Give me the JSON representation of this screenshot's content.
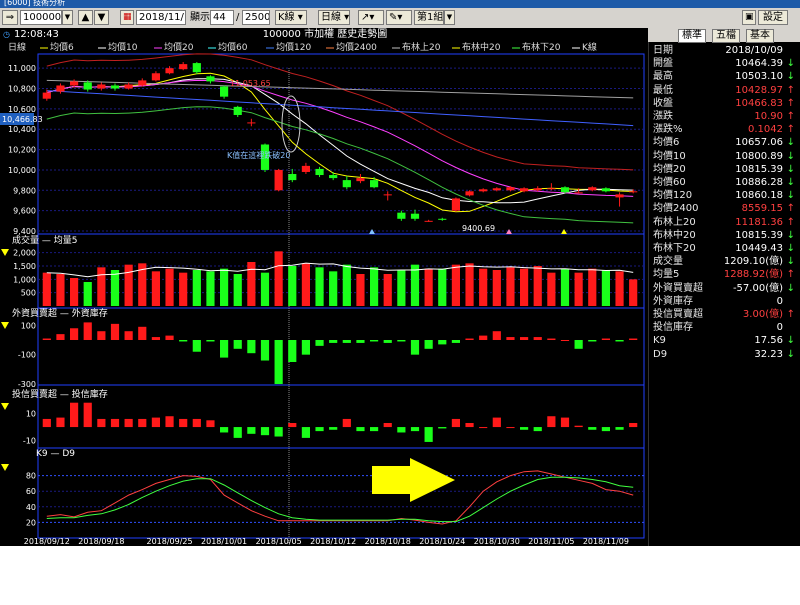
{
  "window": {
    "title": "[6000] 技術分析"
  },
  "toolbar": {
    "symbol": "100000",
    "date": "2018/11/",
    "display_label": "顯示",
    "display_count": "44",
    "display_total": "2500",
    "kline_label": "K線",
    "period_label": "日線",
    "page_label": "第1組",
    "settings_label": "設定"
  },
  "chart_header": {
    "time": "12:08:43",
    "period": "日線",
    "title": "100000 市加權  歷史走勢圖",
    "legend": [
      "均價6",
      "均價10",
      "均價20",
      "均價60",
      "均價120",
      "均價2400",
      "布林上20",
      "布林中20",
      "布林下20",
      "K線"
    ]
  },
  "price_panel": {
    "y_ticks": [
      "11,000",
      "10,800",
      "10,600",
      "10,400",
      "10,200",
      "10,000",
      "9,800",
      "9,600",
      "9,400"
    ],
    "last_price_tag": "10,466.83",
    "high_label": "11,053.65",
    "low_label": "9400.69",
    "annotation": "K值在這裡跌破20"
  },
  "volume_panel": {
    "legend": "成交量 — 均量5",
    "y_ticks": [
      "2,000",
      "1,500",
      "1,000",
      "500"
    ]
  },
  "foreign_panel": {
    "legend": "外資買賣超 — 外資庫存",
    "y_ticks": [
      "100",
      "-100",
      "-300"
    ]
  },
  "trust_panel": {
    "legend": "投信買賣超 — 投信庫存",
    "y_ticks": [
      "10",
      "-10"
    ]
  },
  "kd_panel": {
    "legend": "K9 — D9",
    "y_ticks": [
      "80",
      "60",
      "40",
      "20"
    ]
  },
  "x_dates": [
    "2018/09/12",
    "2018/09/18",
    "2018/09/25",
    "2018/10/01",
    "2018/10/05",
    "2018/10/12",
    "2018/10/18",
    "2018/10/24",
    "2018/10/30",
    "2018/11/05",
    "2018/11/09"
  ],
  "right_panel": {
    "tabs": [
      "標準",
      "五檔",
      "基本"
    ],
    "rows": [
      {
        "label": "日期",
        "value": "2018/10/09",
        "color": "#ffffff",
        "arrow": ""
      },
      {
        "label": "開盤",
        "value": "10464.39",
        "color": "#ffffff",
        "arrow": "↓"
      },
      {
        "label": "最高",
        "value": "10503.10",
        "color": "#ffffff",
        "arrow": "↓"
      },
      {
        "label": "最低",
        "value": "10428.97",
        "color": "#ff4040",
        "arrow": "↑"
      },
      {
        "label": "收盤",
        "value": "10466.83",
        "color": "#ff4040",
        "arrow": "↑"
      },
      {
        "label": "漲跌",
        "value": "10.90",
        "color": "#ff4040",
        "arrow": "↑"
      },
      {
        "label": "漲跌%",
        "value": "0.1042",
        "color": "#ff4040",
        "arrow": "↑"
      },
      {
        "label": "均價6",
        "value": "10657.06",
        "color": "#ffffff",
        "arrow": "↓"
      },
      {
        "label": "均價10",
        "value": "10800.89",
        "color": "#ffffff",
        "arrow": "↓"
      },
      {
        "label": "均價20",
        "value": "10815.39",
        "color": "#ffffff",
        "arrow": "↓"
      },
      {
        "label": "均價60",
        "value": "10886.28",
        "color": "#ffffff",
        "arrow": "↓"
      },
      {
        "label": "均價120",
        "value": "10860.18",
        "color": "#ffffff",
        "arrow": "↓"
      },
      {
        "label": "均價2400",
        "value": "8559.15",
        "color": "#ff4040",
        "arrow": "↑"
      },
      {
        "label": "布林上20",
        "value": "11181.36",
        "color": "#ff4040",
        "arrow": "↑"
      },
      {
        "label": "布林中20",
        "value": "10815.39",
        "color": "#ffffff",
        "arrow": "↓"
      },
      {
        "label": "布林下20",
        "value": "10449.43",
        "color": "#ffffff",
        "arrow": "↓"
      },
      {
        "label": "成交量",
        "value": "1209.10(億)",
        "color": "#ffffff",
        "arrow": "↓"
      },
      {
        "label": "均量5",
        "value": "1288.92(億)",
        "color": "#ff4040",
        "arrow": "↑"
      },
      {
        "label": "外資買賣超",
        "value": "-57.00(億)",
        "color": "#ffffff",
        "arrow": "↓"
      },
      {
        "label": "外資庫存",
        "value": "0",
        "color": "#ffffff",
        "arrow": ""
      },
      {
        "label": "投信買賣超",
        "value": "3.00(億)",
        "color": "#ff4040",
        "arrow": "↑"
      },
      {
        "label": "投信庫存",
        "value": "0",
        "color": "#ffffff",
        "arrow": ""
      },
      {
        "label": "K9",
        "value": "17.56",
        "color": "#ffffff",
        "arrow": "↓"
      },
      {
        "label": "D9",
        "value": "32.23",
        "color": "#ffffff",
        "arrow": "↓"
      }
    ]
  },
  "colors": {
    "up": "#ff1a1a",
    "down": "#1aff1a",
    "grid": "#1a1a80",
    "arrow": "#ffff00"
  },
  "chart_data": {
    "type": "candlestick",
    "candles": [
      {
        "o": 10700,
        "c": 10760,
        "h": 10790,
        "l": 10680
      },
      {
        "o": 10770,
        "c": 10830,
        "h": 10850,
        "l": 10750
      },
      {
        "o": 10830,
        "c": 10870,
        "h": 10890,
        "l": 10810
      },
      {
        "o": 10860,
        "c": 10790,
        "h": 10880,
        "l": 10770
      },
      {
        "o": 10800,
        "c": 10840,
        "h": 10860,
        "l": 10780
      },
      {
        "o": 10830,
        "c": 10800,
        "h": 10850,
        "l": 10780
      },
      {
        "o": 10800,
        "c": 10840,
        "h": 10860,
        "l": 10790
      },
      {
        "o": 10830,
        "c": 10880,
        "h": 10900,
        "l": 10820
      },
      {
        "o": 10880,
        "c": 10950,
        "h": 10970,
        "l": 10870
      },
      {
        "o": 10950,
        "c": 11000,
        "h": 11020,
        "l": 10940
      },
      {
        "o": 10990,
        "c": 11040,
        "h": 11060,
        "l": 10980
      },
      {
        "o": 11050,
        "c": 10960,
        "h": 11060,
        "l": 10940
      },
      {
        "o": 10920,
        "c": 10870,
        "h": 10930,
        "l": 10850
      },
      {
        "o": 10820,
        "c": 10720,
        "h": 10830,
        "l": 10700
      },
      {
        "o": 10620,
        "c": 10540,
        "h": 10630,
        "l": 10520
      },
      {
        "o": 10464,
        "c": 10467,
        "h": 10503,
        "l": 10429
      },
      {
        "o": 10250,
        "c": 10000,
        "h": 10260,
        "l": 9980
      },
      {
        "o": 9800,
        "c": 10000,
        "h": 10010,
        "l": 9790
      },
      {
        "o": 9960,
        "c": 9900,
        "h": 10010,
        "l": 9880
      },
      {
        "o": 9980,
        "c": 10040,
        "h": 10070,
        "l": 9960
      },
      {
        "o": 10010,
        "c": 9950,
        "h": 10030,
        "l": 9930
      },
      {
        "o": 9950,
        "c": 9920,
        "h": 9980,
        "l": 9900
      },
      {
        "o": 9900,
        "c": 9830,
        "h": 9940,
        "l": 9810
      },
      {
        "o": 9890,
        "c": 9920,
        "h": 9960,
        "l": 9870
      },
      {
        "o": 9900,
        "c": 9830,
        "h": 9930,
        "l": 9820
      },
      {
        "o": 9760,
        "c": 9760,
        "h": 9790,
        "l": 9700
      },
      {
        "o": 9580,
        "c": 9520,
        "h": 9600,
        "l": 9500
      },
      {
        "o": 9570,
        "c": 9520,
        "h": 9610,
        "l": 9501
      },
      {
        "o": 9500,
        "c": 9500,
        "h": 9510,
        "l": 9490
      },
      {
        "o": 9520,
        "c": 9510,
        "h": 9530,
        "l": 9500
      },
      {
        "o": 9600,
        "c": 9720,
        "h": 9730,
        "l": 9590
      },
      {
        "o": 9750,
        "c": 9790,
        "h": 9800,
        "l": 9740
      },
      {
        "o": 9790,
        "c": 9810,
        "h": 9820,
        "l": 9780
      },
      {
        "o": 9800,
        "c": 9820,
        "h": 9830,
        "l": 9790
      },
      {
        "o": 9800,
        "c": 9830,
        "h": 9840,
        "l": 9790
      },
      {
        "o": 9790,
        "c": 9820,
        "h": 9830,
        "l": 9780
      },
      {
        "o": 9800,
        "c": 9820,
        "h": 9840,
        "l": 9790
      },
      {
        "o": 9820,
        "c": 9820,
        "h": 9870,
        "l": 9800
      },
      {
        "o": 9830,
        "c": 9780,
        "h": 9840,
        "l": 9770
      },
      {
        "o": 9780,
        "c": 9780,
        "h": 9820,
        "l": 9770
      },
      {
        "o": 9800,
        "c": 9830,
        "h": 9840,
        "l": 9790
      },
      {
        "o": 9820,
        "c": 9790,
        "h": 9830,
        "l": 9780
      },
      {
        "o": 9730,
        "c": 9760,
        "h": 9780,
        "l": 9640
      },
      {
        "o": 9790,
        "c": 9790,
        "h": 9810,
        "l": 9770
      }
    ],
    "volume": [
      1250,
      1200,
      1050,
      900,
      1450,
      1350,
      1550,
      1600,
      1300,
      1400,
      1250,
      1350,
      1300,
      1400,
      1200,
      1650,
      1250,
      2050,
      1500,
      1600,
      1450,
      1300,
      1550,
      1200,
      1450,
      1200,
      1350,
      1550,
      1400,
      1400,
      1550,
      1600,
      1400,
      1350,
      1450,
      1400,
      1500,
      1250,
      1400,
      1250,
      1400,
      1350,
      1300,
      1000
    ],
    "foreign": [
      10,
      40,
      80,
      120,
      60,
      110,
      60,
      90,
      20,
      30,
      -10,
      -80,
      -10,
      -120,
      -60,
      -90,
      -140,
      -300,
      -150,
      -100,
      -40,
      -20,
      -20,
      -20,
      -10,
      -20,
      -10,
      -100,
      -60,
      -30,
      -20,
      10,
      30,
      60,
      20,
      20,
      20,
      10,
      0,
      -60,
      -10,
      10,
      -10,
      10
    ],
    "trust": [
      6,
      7,
      18,
      18,
      6,
      6,
      6,
      6,
      7,
      8,
      6,
      6,
      5,
      -4,
      -8,
      -5,
      -6,
      -7,
      3,
      -8,
      -3,
      -2,
      6,
      -3,
      -3,
      3,
      -4,
      -3,
      -11,
      -1,
      6,
      3,
      0,
      7,
      0,
      -2,
      -3,
      8,
      7,
      1,
      -2,
      -3,
      -2,
      3
    ],
    "k9": [
      28,
      30,
      27,
      33,
      35,
      45,
      55,
      62,
      70,
      75,
      80,
      79,
      75,
      55,
      45,
      35,
      28,
      22,
      22,
      22,
      22,
      22,
      22,
      22,
      22,
      22,
      25,
      23,
      20,
      18,
      22,
      40,
      60,
      72,
      80,
      85,
      86,
      82,
      78,
      74,
      70,
      62,
      60,
      55
    ],
    "d9": [
      25,
      26,
      26,
      29,
      31,
      36,
      43,
      52,
      60,
      67,
      73,
      76,
      76,
      68,
      58,
      48,
      39,
      31,
      26,
      24,
      23,
      23,
      23,
      23,
      23,
      23,
      24,
      24,
      22,
      21,
      21,
      28,
      39,
      50,
      60,
      68,
      75,
      78,
      78,
      77,
      75,
      72,
      67,
      65
    ],
    "y_range": [
      9400,
      11100
    ]
  }
}
